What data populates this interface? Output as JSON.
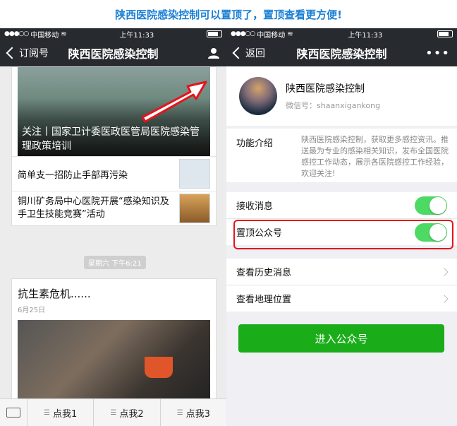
{
  "banner": "陕西医院感染控制可以置顶了，置顶查看更方便!",
  "status": {
    "carrier": "中国移动",
    "time": "上午11:33"
  },
  "left": {
    "nav": {
      "back_label": "订阅号",
      "title": "陕西医院感染控制"
    },
    "article_main": "关注丨国家卫计委医政医管局医院感染管理政策培训",
    "articles": [
      "简单支一招防止手部再污染",
      "铜川矿务局中心医院开展“感染知识及手卫生技能竞赛”活动"
    ],
    "timestamp": "星期六 下午6:21",
    "post": {
      "title": "抗生素危机......",
      "date": "6月25日"
    },
    "menu": [
      "点我1",
      "点我2",
      "点我3"
    ]
  },
  "right": {
    "nav": {
      "back_label": "返回",
      "title": "陕西医院感染控制"
    },
    "profile": {
      "name": "陕西医院感染控制",
      "wechat_id": "微信号：shaanxiganko​ng"
    },
    "intro": {
      "label": "功能介绍",
      "text": "陕西医院感染控制，获取更多感控资讯。推送最为专业的感染相关知识，发布全国医院感控工作动态，展示各医院感控工作经验，欢迎关注!"
    },
    "receive_label": "接收消息",
    "pin_label": "置顶公众号",
    "history_label": "查看历史消息",
    "location_label": "查看地理位置",
    "enter_button": "进入公众号"
  },
  "colors": {
    "accent_banner": "#1a7fd4",
    "nav_bg": "#272a2f",
    "toggle_on": "#4cd964",
    "highlight_red": "#e3141d",
    "button_green": "#1aad19"
  }
}
